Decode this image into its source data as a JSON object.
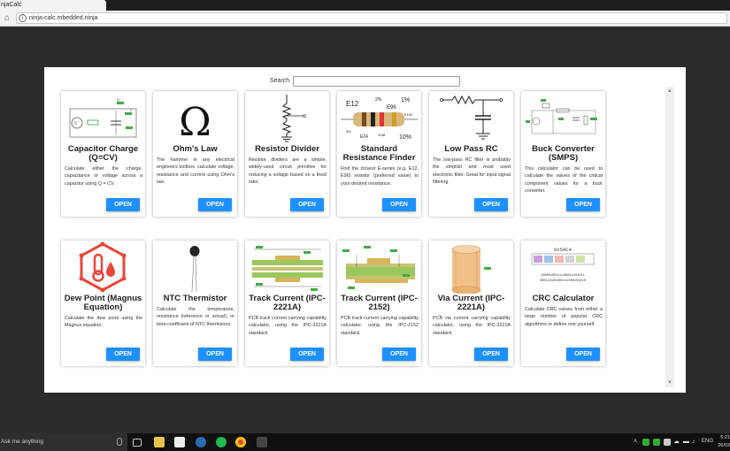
{
  "browser": {
    "tab_title": "njaCalc",
    "url": "ninja-calc.mbedded.ninja"
  },
  "search": {
    "label": "Search",
    "placeholder": ""
  },
  "cards": [
    {
      "title": "Capacitor Charge (Q=CV)",
      "description": "Calculate either the charge, capacitance or voltage across a capacitor using Q = CV.",
      "button": "OPEN",
      "icon": "capacitor-circuit-icon"
    },
    {
      "title": "Ohm's Law",
      "description": "The hammer in any electrical engineers toolbox. calculate voltage, resistance and current using Ohm's law.",
      "button": "OPEN",
      "icon": "omega-icon"
    },
    {
      "title": "Resistor Divider",
      "description": "Resistor dividers are a simple, widely-used circuit primitive for reducing a voltage based on a fixed ratio.",
      "button": "OPEN",
      "icon": "resistor-divider-icon"
    },
    {
      "title": "Standard Resistance Finder",
      "description": "Find the closest E-series (e.g. E12, E96) resistor (preferred value) to your desired resistance.",
      "button": "OPEN",
      "icon": "resistor-bands-icon"
    },
    {
      "title": "Low Pass RC",
      "description": "The low-pass RC filter is probably the simplist and most used electronic filter. Great for input signal filtering.",
      "button": "OPEN",
      "icon": "low-pass-filter-icon"
    },
    {
      "title": "Buck Converter (SMPS)",
      "description": "This calculator can be used to calculate the values of the critical component values for a buck converter.",
      "button": "OPEN",
      "icon": "buck-converter-icon"
    },
    {
      "title": "Dew Point (Magnus Equation)",
      "description": "Calculate the dew point using the Magnus equation.",
      "button": "OPEN",
      "icon": "dew-point-icon"
    },
    {
      "title": "NTC Thermistor",
      "description": "Calculate the temperature, resistance (reference or actual), or beta-coefficient of NTC thermistors.",
      "button": "OPEN",
      "icon": "thermistor-icon"
    },
    {
      "title": "Track Current (IPC-2221A)",
      "description": "PCB track current carrying capability calculator, using the IPC-2221A standard.",
      "button": "OPEN",
      "icon": "pcb-track-icon"
    },
    {
      "title": "Track Current (IPC-2152)",
      "description": "PCB track current carrying capability calculator, using the IPC-2152 standard.",
      "button": "OPEN",
      "icon": "pcb-track-2152-icon"
    },
    {
      "title": "Via Current (IPC-2221A)",
      "description": "PCB via current carrying capability calculator, using the IPC-2221A standard.",
      "button": "OPEN",
      "icon": "pcb-via-icon"
    },
    {
      "title": "CRC Calculator",
      "description": "Calculate CRC values from either a large number of popular CRC algorithms or define one yourself.",
      "button": "OPEN",
      "icon": "crc-icon"
    }
  ],
  "icon_text": {
    "resistor": {
      "e12": "E12",
      "e96": "E96",
      "e24": "E24",
      "e48": "E48",
      "p2": "2%",
      "p1": "1%",
      "p5": "5%",
      "p10": "10%",
      "e192": "E192"
    },
    "crc": {
      "hex": "0x5AC4",
      "bits1": "10000100111100011101011",
      "bits2": "000110101000111000101010"
    }
  },
  "taskbar": {
    "search_text": "Ask me anything",
    "time": "5:21",
    "date": "26/03",
    "language": "ENG"
  },
  "colors": {
    "accent": "#1e90ff",
    "dew_red": "#e8473a"
  }
}
